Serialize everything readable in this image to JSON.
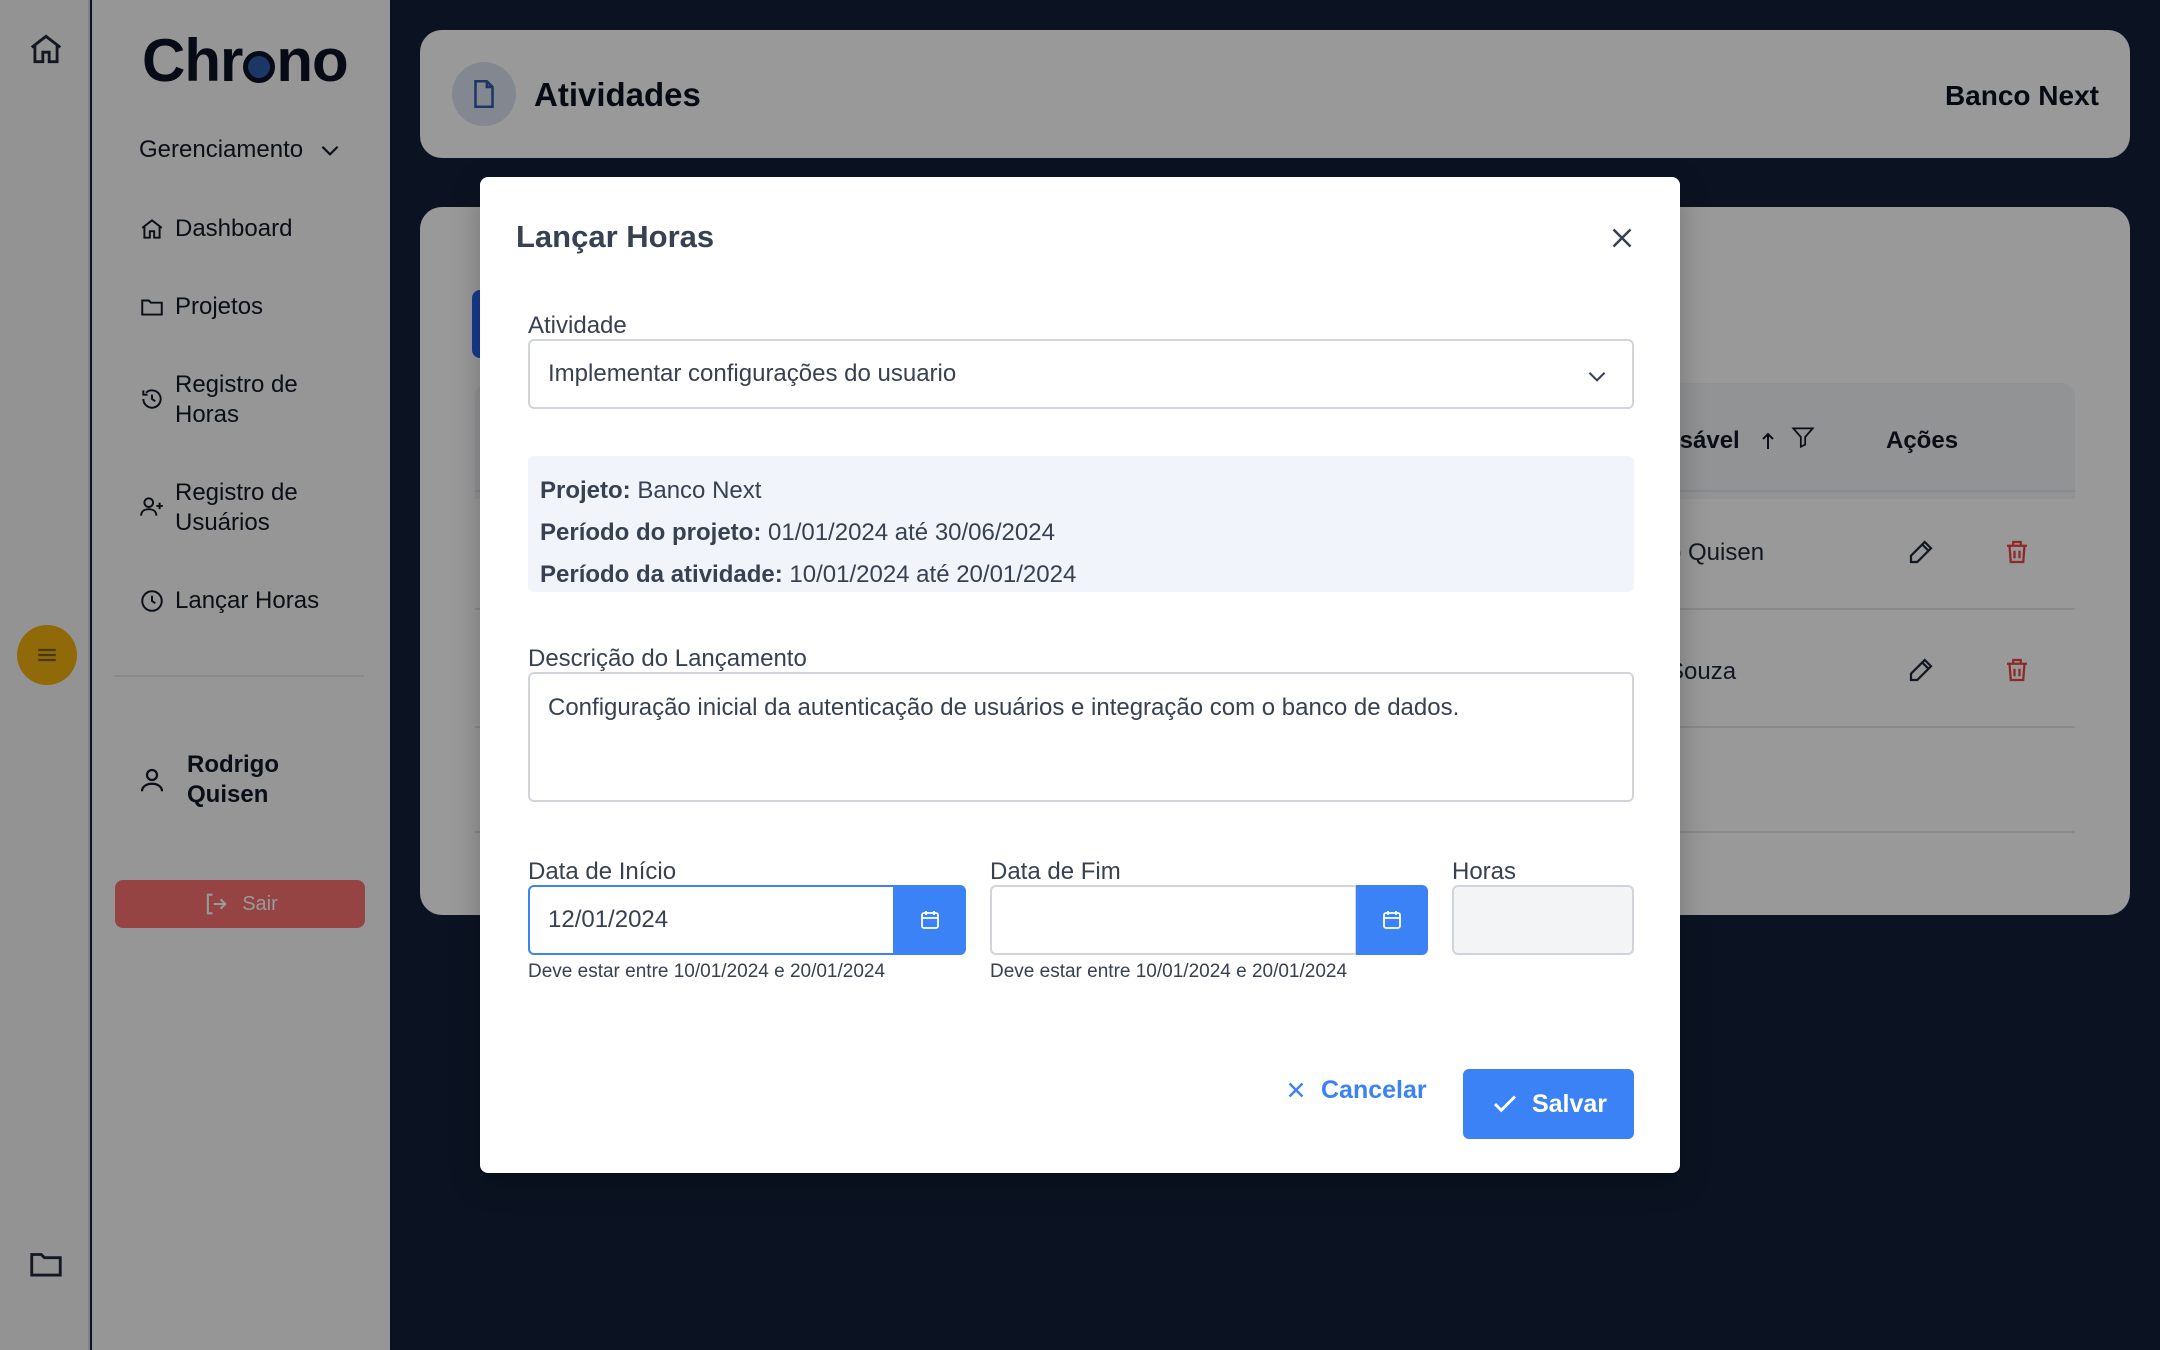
{
  "sidebar": {
    "logo": "Chr",
    "logo_tail": "no",
    "management_label": "Gerenciamento",
    "items": [
      {
        "label": "Dashboard"
      },
      {
        "label": "Projetos"
      },
      {
        "label": "Registro de Horas"
      },
      {
        "label": "Registro de Usuários"
      },
      {
        "label": "Lançar Horas"
      }
    ],
    "user_name": "Rodrigo Quisen",
    "logout_label": "Sair"
  },
  "header": {
    "title": "Atividades",
    "project": "Banco Next"
  },
  "table": {
    "columns": {
      "responsavel": "nsável",
      "acoes": "Ações"
    },
    "rows": [
      {
        "responsavel": "o Quisen"
      },
      {
        "responsavel": "Souza"
      }
    ]
  },
  "modal": {
    "title": "Lançar Horas",
    "activity_label": "Atividade",
    "activity_value": "Implementar configurações do usuario",
    "info": {
      "project_label": "Projeto:",
      "project_value": "Banco Next",
      "project_period_label": "Período do projeto:",
      "project_period_value": "01/01/2024 até 30/06/2024",
      "activity_period_label": "Período da atividade:",
      "activity_period_value": "10/01/2024 até 20/01/2024"
    },
    "description_label": "Descrição do Lançamento",
    "description_value": "Configuração inicial da autenticação de usuários e integração com o banco de dados.",
    "start_label": "Data de Início",
    "start_value": "12/01/2024",
    "start_hint": "Deve estar entre 10/01/2024 e 20/01/2024",
    "end_label": "Data de Fim",
    "end_value": "",
    "end_hint": "Deve estar entre 10/01/2024 e 20/01/2024",
    "hours_label": "Horas",
    "cancel_label": "Cancelar",
    "save_label": "Salvar"
  },
  "colors": {
    "accent": "#3b82f6",
    "background": "#132039",
    "menu_button": "#f0b10e",
    "danger": "#f87171"
  }
}
